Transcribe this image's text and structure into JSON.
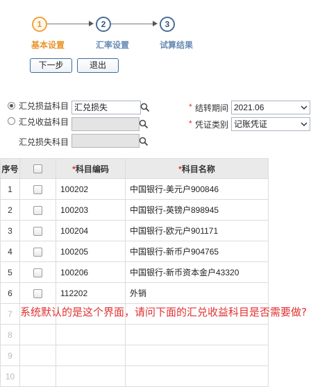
{
  "wizard": {
    "steps": [
      {
        "number": "1",
        "label": "基本设置",
        "active": true
      },
      {
        "number": "2",
        "label": "汇率设置",
        "active": false
      },
      {
        "number": "3",
        "label": "试算结果",
        "active": false
      }
    ],
    "next_label": "下一步",
    "exit_label": "退出"
  },
  "form": {
    "gain_loss_label": "汇兑损益科目",
    "gain_loss_value": "汇兑损失",
    "income_label": "汇兑收益科目",
    "income_value": "",
    "loss_label": "汇兑损失科目",
    "loss_value": "",
    "period_label": "结转期间",
    "period_value": "2021.06",
    "voucher_label": "凭证类别",
    "voucher_value": "记账凭证",
    "required_mark": "*"
  },
  "grid": {
    "columns": {
      "index": "序号",
      "code": "科目编码",
      "name": "科目名称"
    },
    "rows": [
      {
        "index": "1",
        "code": "100202",
        "name": "中国银行-美元户900846"
      },
      {
        "index": "2",
        "code": "100203",
        "name": "中国银行-英镑户898945"
      },
      {
        "index": "3",
        "code": "100204",
        "name": "中国银行-欧元户901171"
      },
      {
        "index": "4",
        "code": "100205",
        "name": "中国银行-新币户904765"
      },
      {
        "index": "5",
        "code": "100206",
        "name": "中国银行-新币资本金户43320"
      },
      {
        "index": "6",
        "code": "112202",
        "name": "外销"
      },
      {
        "index": "7",
        "code": "",
        "name": ""
      },
      {
        "index": "8",
        "code": "",
        "name": ""
      },
      {
        "index": "9",
        "code": "",
        "name": ""
      },
      {
        "index": "10",
        "code": "",
        "name": ""
      }
    ]
  },
  "annotation": "系统默认的是这个界面，请问下面的汇兑收益科目是否需要做?",
  "colors": {
    "active_step": "#e8962f",
    "inactive_step": "#34577f",
    "required": "#d9342b",
    "annotation": "#e03131"
  }
}
